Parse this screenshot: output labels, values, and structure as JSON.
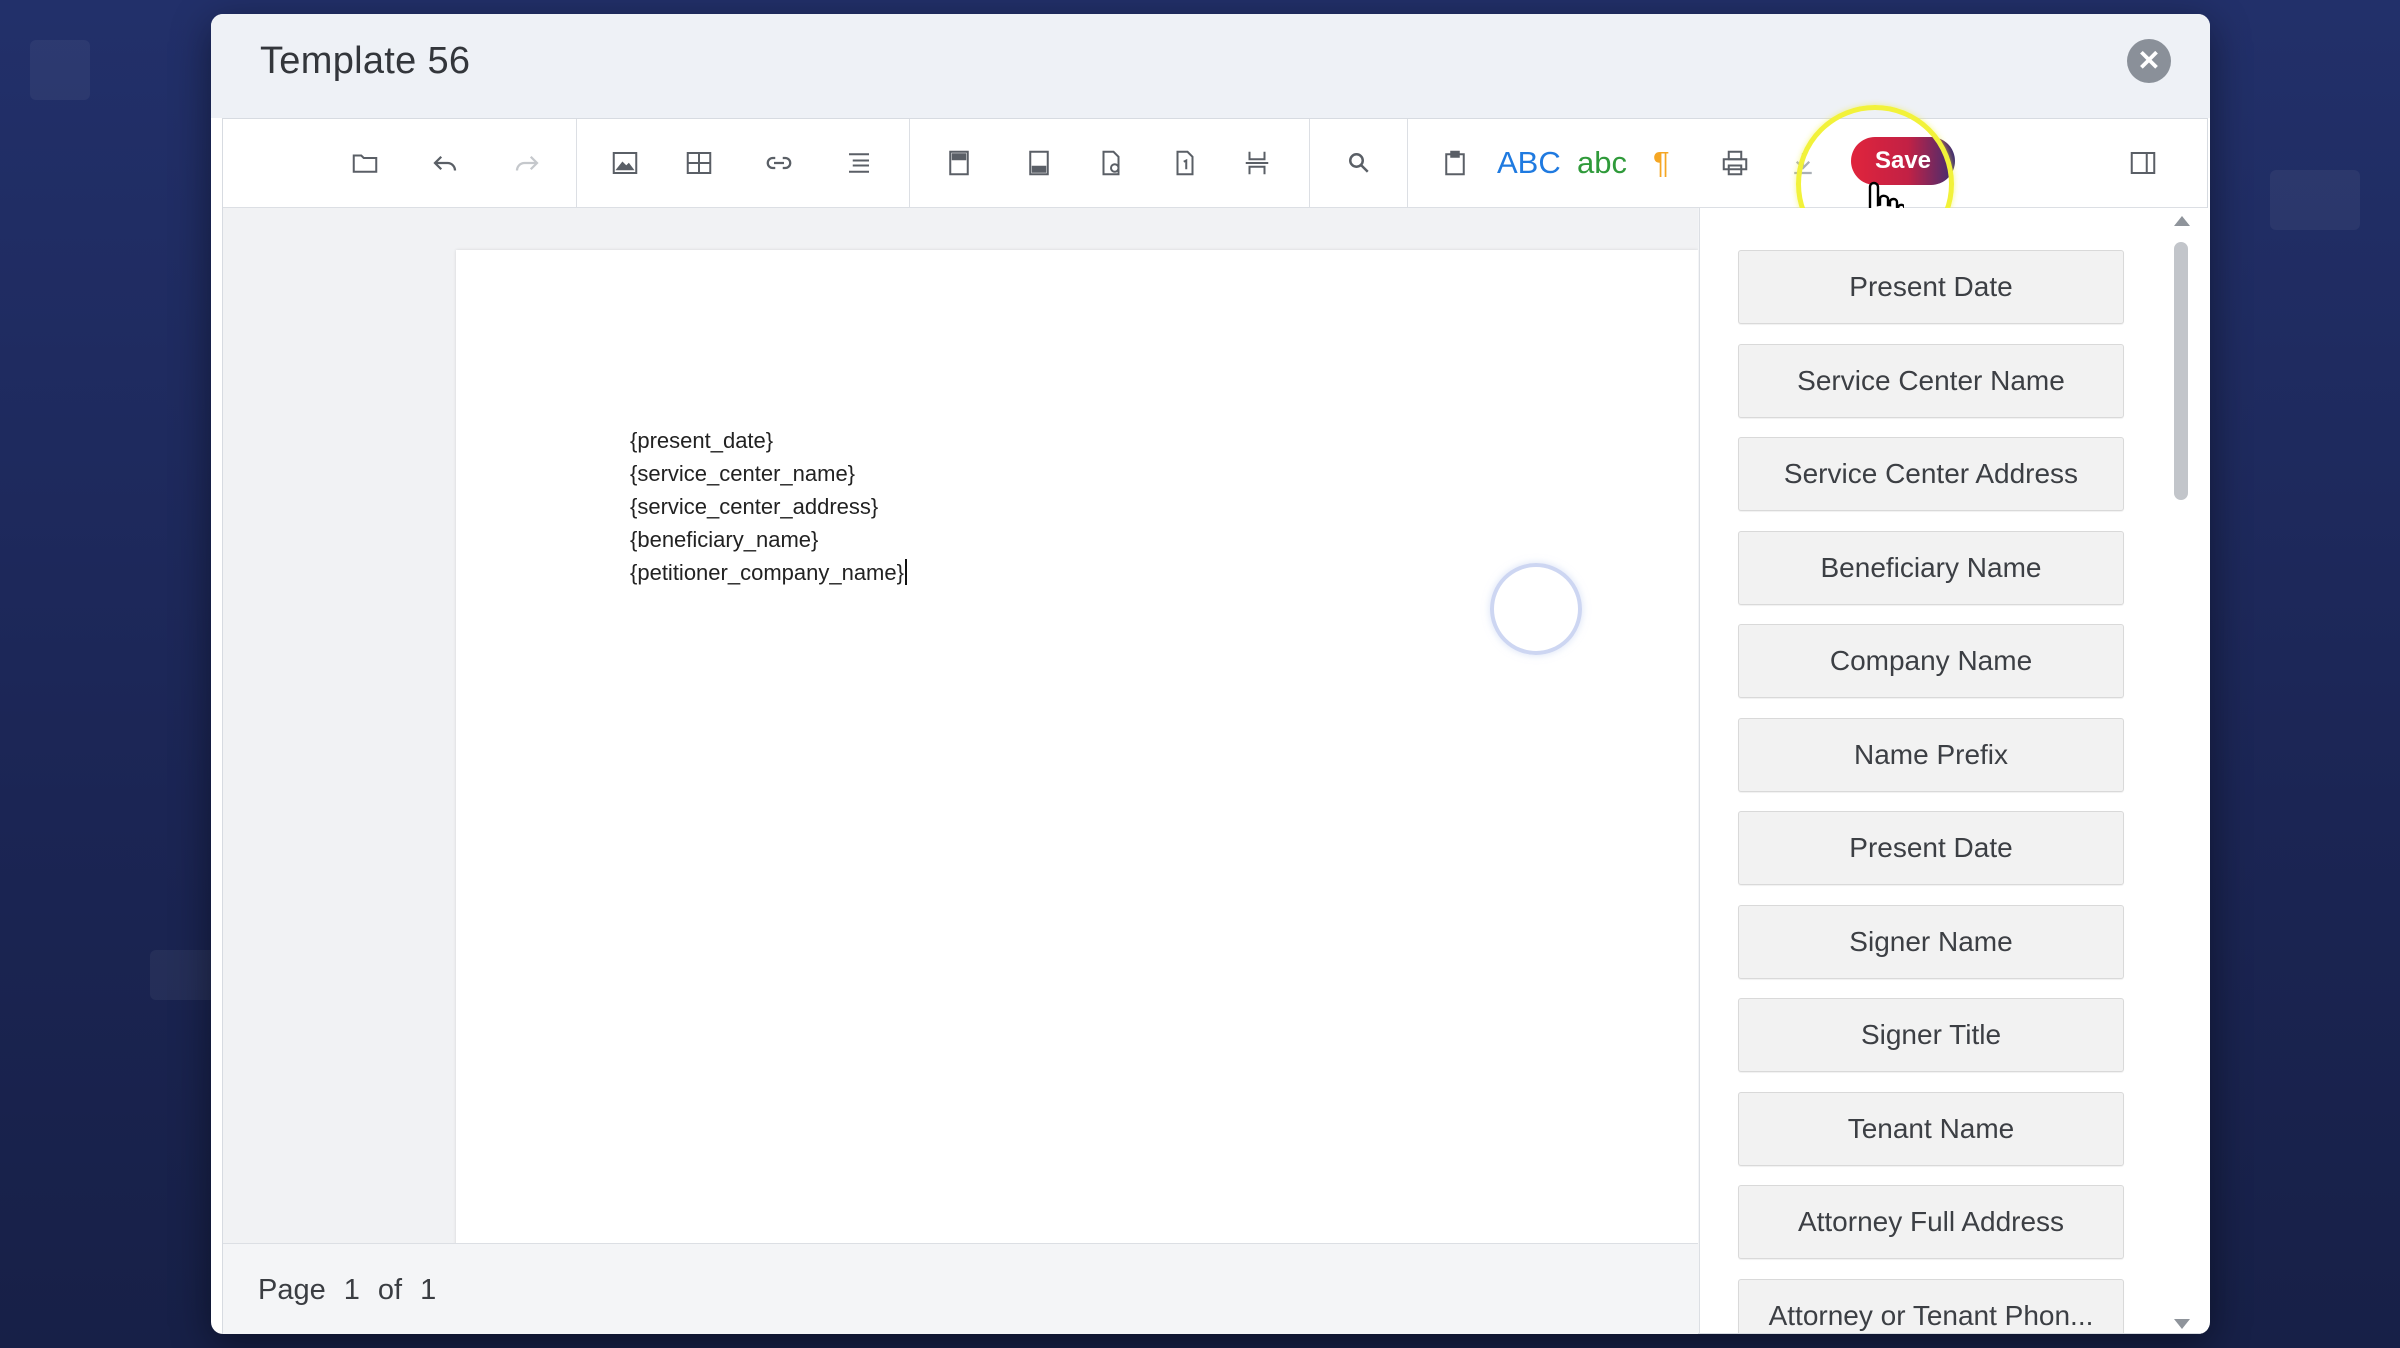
{
  "dialog": {
    "title": "Template 56",
    "close_label": "✕"
  },
  "toolbar": {
    "spell_check_upper": "ABC",
    "spell_check_lower": "abc",
    "paragraph_mark": "¶",
    "save_label": "Save",
    "spell_upper_color": "#1f7ae0",
    "spell_lower_color": "#2f9a3a",
    "paragraph_color": "#f5a623",
    "save_gradient": [
      "#e0243c",
      "#c22145",
      "#3d2e72"
    ]
  },
  "document": {
    "lines": [
      "{present_date}",
      "{service_center_name}",
      "{service_center_address}",
      "{beneficiary_name}",
      "{petitioner_company_name}"
    ]
  },
  "status": {
    "page_label": "Page",
    "current_page": "1",
    "of_label": "of",
    "total_pages": "1"
  },
  "fields": [
    "Present Date",
    "Service Center Name",
    "Service Center Address",
    "Beneficiary Name",
    "Company Name",
    "Name Prefix",
    "Present Date",
    "Signer Name",
    "Signer Title",
    "Tenant Name",
    "Attorney Full Address",
    "Attorney or Tenant Phon..."
  ]
}
